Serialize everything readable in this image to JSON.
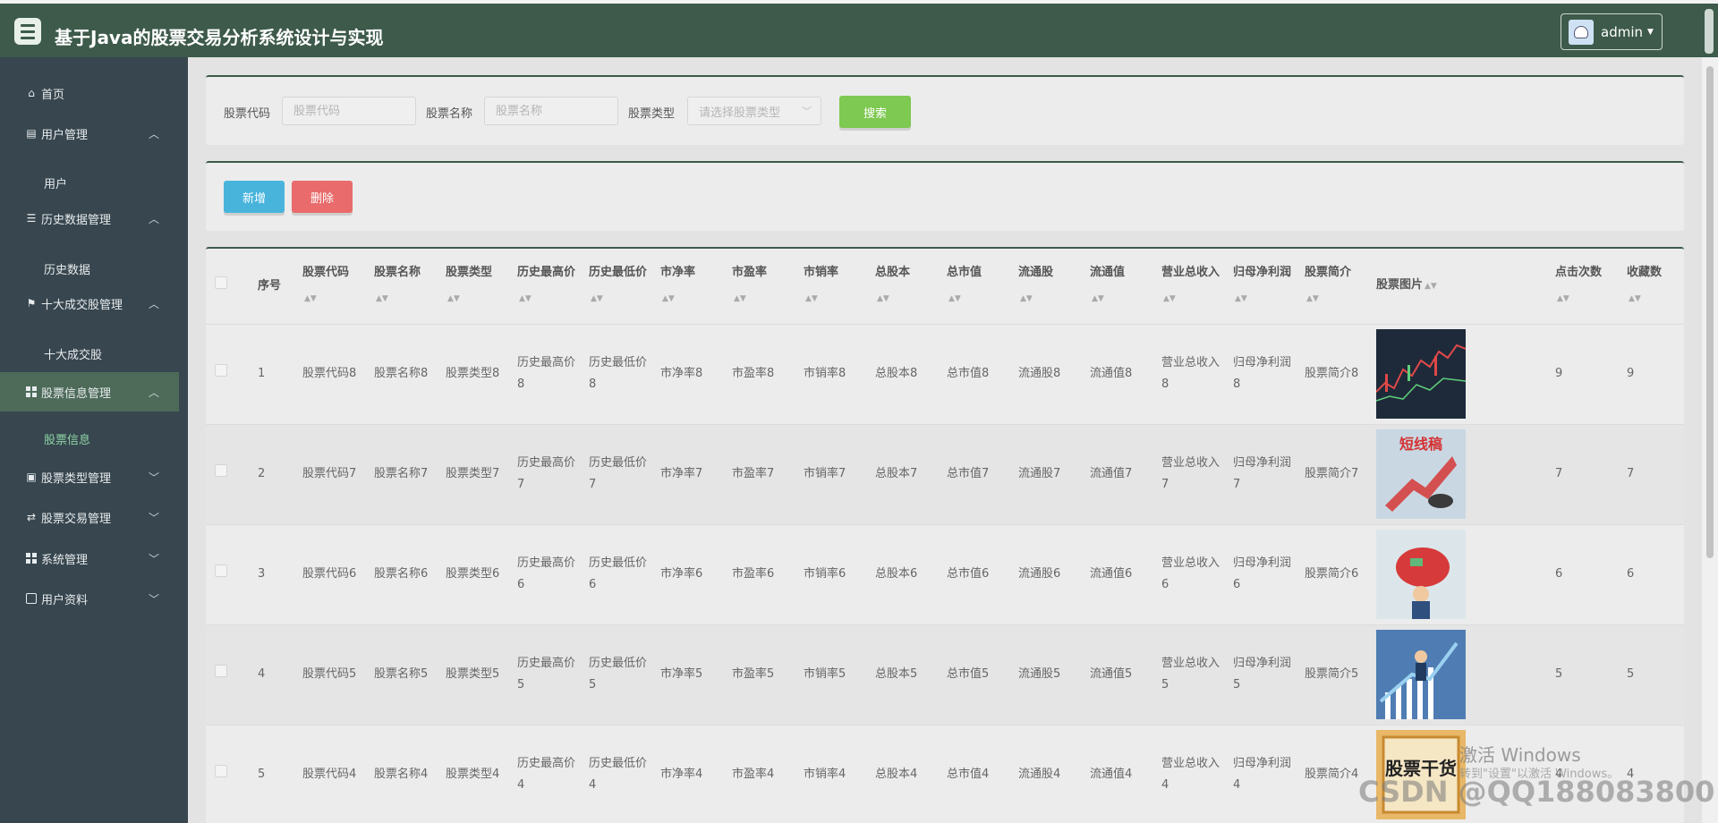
{
  "header": {
    "title": "基于Java的股票交易分析系统设计与实现",
    "user": "admin"
  },
  "sidebar": {
    "items": [
      {
        "label": "首页"
      },
      {
        "label": "用户管理"
      },
      {
        "label": "用户"
      },
      {
        "label": "历史数据管理"
      },
      {
        "label": "历史数据"
      },
      {
        "label": "十大成交股管理"
      },
      {
        "label": "十大成交股"
      },
      {
        "label": "股票信息管理"
      },
      {
        "label": "股票信息"
      },
      {
        "label": "股票类型管理"
      },
      {
        "label": "股票交易管理"
      },
      {
        "label": "系统管理"
      },
      {
        "label": "用户资料"
      }
    ]
  },
  "search": {
    "code_label": "股票代码",
    "code_placeholder": "股票代码",
    "name_label": "股票名称",
    "name_placeholder": "股票名称",
    "type_label": "股票类型",
    "type_placeholder": "请选择股票类型",
    "search_button": "搜索"
  },
  "actions": {
    "add": "新增",
    "delete": "删除"
  },
  "table": {
    "headers": [
      "序号",
      "股票代码",
      "股票名称",
      "股票类型",
      "历史最高价",
      "历史最低价",
      "市净率",
      "市盈率",
      "市销率",
      "总股本",
      "总市值",
      "流通股",
      "流通值",
      "营业总收入",
      "归母净利润",
      "股票简介",
      "股票图片",
      "点击次数",
      "收藏数"
    ],
    "rows": [
      {
        "no": "1",
        "code": "股票代码8",
        "name": "股票名称8",
        "type": "股票类型8",
        "high": "历史最高价8",
        "low": "历史最低价8",
        "pb": "市净率8",
        "pe": "市盈率8",
        "ps": "市销率8",
        "shares": "总股本8",
        "mcap": "总市值8",
        "float": "流通股8",
        "fmv": "流通值8",
        "revenue": "营业总收入8",
        "profit": "归母净利润8",
        "intro": "股票简介8",
        "clicks": "9",
        "favs": "9"
      },
      {
        "no": "2",
        "code": "股票代码7",
        "name": "股票名称7",
        "type": "股票类型7",
        "high": "历史最高价7",
        "low": "历史最低价7",
        "pb": "市净率7",
        "pe": "市盈率7",
        "ps": "市销率7",
        "shares": "总股本7",
        "mcap": "总市值7",
        "float": "流通股7",
        "fmv": "流通值7",
        "revenue": "营业总收入7",
        "profit": "归母净利润7",
        "intro": "股票简介7",
        "img_text": "短线稿",
        "clicks": "7",
        "favs": "7"
      },
      {
        "no": "3",
        "code": "股票代码6",
        "name": "股票名称6",
        "type": "股票类型6",
        "high": "历史最高价6",
        "low": "历史最低价6",
        "pb": "市净率6",
        "pe": "市盈率6",
        "ps": "市销率6",
        "shares": "总股本6",
        "mcap": "总市值6",
        "float": "流通股6",
        "fmv": "流通值6",
        "revenue": "营业总收入6",
        "profit": "归母净利润6",
        "intro": "股票简介6",
        "clicks": "6",
        "favs": "6"
      },
      {
        "no": "4",
        "code": "股票代码5",
        "name": "股票名称5",
        "type": "股票类型5",
        "high": "历史最高价5",
        "low": "历史最低价5",
        "pb": "市净率5",
        "pe": "市盈率5",
        "ps": "市销率5",
        "shares": "总股本5",
        "mcap": "总市值5",
        "float": "流通股5",
        "fmv": "流通值5",
        "revenue": "营业总收入5",
        "profit": "归母净利润5",
        "intro": "股票简介5",
        "clicks": "5",
        "favs": "5"
      },
      {
        "no": "5",
        "code": "股票代码4",
        "name": "股票名称4",
        "type": "股票类型4",
        "high": "历史最高价4",
        "low": "历史最低价4",
        "pb": "市净率4",
        "pe": "市盈率4",
        "ps": "市销率4",
        "shares": "总股本4",
        "mcap": "总市值4",
        "float": "流通股4",
        "fmv": "流通值4",
        "revenue": "营业总收入4",
        "profit": "归母净利润4",
        "intro": "股票简介4",
        "img_text": "股票干货",
        "clicks": "4",
        "favs": "4"
      }
    ]
  },
  "watermark": {
    "activate_title": "激活 Windows",
    "activate_sub": "转到\"设置\"以激活 Windows。",
    "csdn": "CSDN @QQ188083800"
  }
}
